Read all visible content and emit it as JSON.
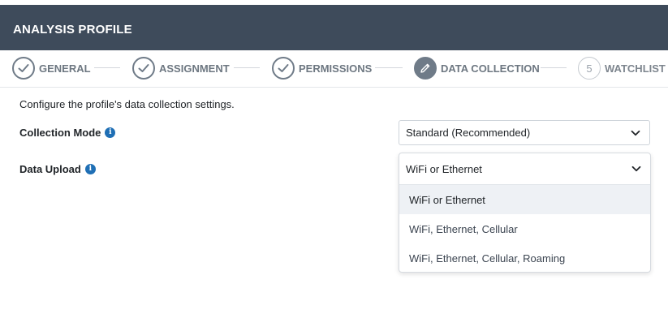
{
  "dialog": {
    "title": "ANALYSIS PROFILE"
  },
  "stepper": {
    "steps": [
      {
        "label": "GENERAL",
        "state": "done",
        "icon": "check-icon"
      },
      {
        "label": "ASSIGNMENT",
        "state": "done",
        "icon": "check-icon"
      },
      {
        "label": "PERMISSIONS",
        "state": "done",
        "icon": "check-icon"
      },
      {
        "label": "DATA COLLECTION",
        "state": "active",
        "icon": "pencil-icon"
      },
      {
        "label": "WATCHLIST",
        "state": "pending",
        "number": "5"
      }
    ]
  },
  "content": {
    "description": "Configure the profile's data collection settings."
  },
  "fields": {
    "collection_mode": {
      "label": "Collection Mode",
      "info_icon": "info-icon",
      "value": "Standard (Recommended)"
    },
    "data_upload": {
      "label": "Data Upload",
      "info_icon": "info-icon",
      "value": "WiFi or Ethernet",
      "options": [
        "WiFi or Ethernet",
        "WiFi, Ethernet, Cellular",
        "WiFi, Ethernet, Cellular, Roaming"
      ]
    }
  },
  "colors": {
    "header_bg": "#3e4b5b",
    "step_gray": "#6f7b88",
    "info_blue": "#1f6fb5",
    "selected_option_bg": "#eef1f5"
  }
}
